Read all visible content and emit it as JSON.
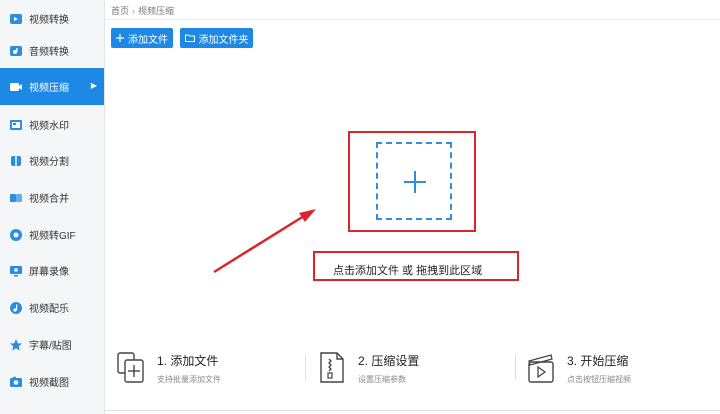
{
  "sidebar": {
    "items": [
      {
        "label": "视频转换",
        "icon": "video-convert-icon"
      },
      {
        "label": "音频转换",
        "icon": "audio-convert-icon"
      },
      {
        "label": "视频压缩",
        "icon": "video-compress-icon",
        "active": true
      },
      {
        "label": "视频水印",
        "icon": "watermark-icon"
      },
      {
        "label": "视频分割",
        "icon": "split-icon"
      },
      {
        "label": "视频合并",
        "icon": "merge-icon"
      },
      {
        "label": "视频转GIF",
        "icon": "gif-icon"
      },
      {
        "label": "屏幕录像",
        "icon": "screen-record-icon"
      },
      {
        "label": "视频配乐",
        "icon": "music-icon"
      },
      {
        "label": "字幕/贴图",
        "icon": "subtitle-icon"
      },
      {
        "label": "视频截图",
        "icon": "screenshot-icon"
      }
    ]
  },
  "breadcrumb": {
    "home": "首页",
    "current": "视频压缩"
  },
  "toolbar": {
    "add_file_label": "添加文件",
    "add_folder_label": "添加文件夹"
  },
  "dropzone": {
    "hint": "点击添加文件 或 拖拽到此区域"
  },
  "steps": [
    {
      "title": "1. 添加文件",
      "desc": "支持批量添加文件"
    },
    {
      "title": "2. 压缩设置",
      "desc": "设置压缩参数"
    },
    {
      "title": "3. 开始压缩",
      "desc": "点击按钮压缩视频"
    }
  ],
  "colors": {
    "accent": "#1e88e5",
    "annotation_red": "#d8262c",
    "dashed_blue": "#2f8ee0"
  }
}
